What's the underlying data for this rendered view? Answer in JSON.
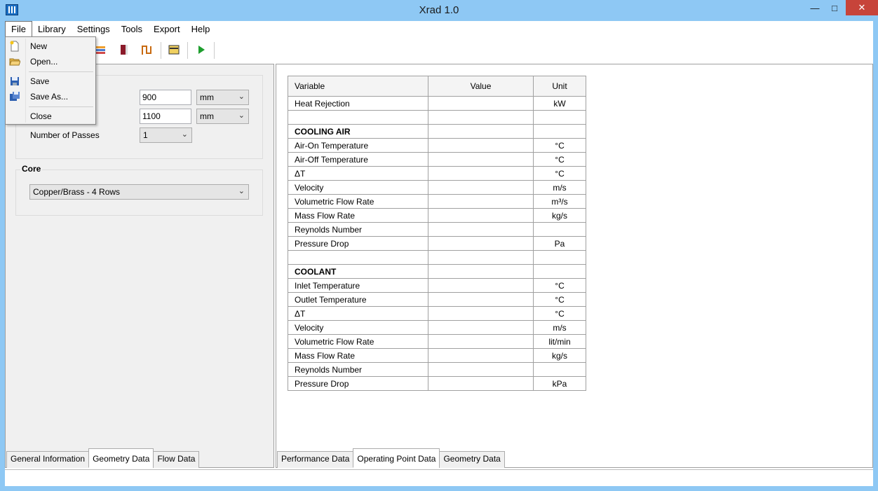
{
  "window": {
    "title": "Xrad 1.0"
  },
  "menu": {
    "items": [
      "File",
      "Library",
      "Settings",
      "Tools",
      "Export",
      "Help"
    ]
  },
  "file_menu": {
    "items": [
      {
        "label": "New",
        "icon": "new-file-icon"
      },
      {
        "label": "Open...",
        "icon": "open-folder-icon"
      },
      {
        "label": "Save",
        "icon": "save-disk-icon"
      },
      {
        "label": "Save As...",
        "icon": "save-as-icon"
      },
      {
        "label": "Close",
        "icon": ""
      }
    ]
  },
  "geometry": {
    "width_value": "900",
    "width_unit": "mm",
    "height_value": "1100",
    "height_unit": "mm",
    "passes_label": "Number of Passes",
    "passes_value": "1"
  },
  "core": {
    "label": "Core",
    "value": "Copper/Brass - 4 Rows"
  },
  "left_tabs": [
    "General Information",
    "Geometry Data",
    "Flow Data"
  ],
  "left_selected_tab": "Geometry Data",
  "right_tabs": [
    "Performance Data",
    "Operating Point Data",
    "Geometry Data"
  ],
  "right_selected_tab": "Operating Point Data",
  "table": {
    "headers": [
      "Variable",
      "Value",
      "Unit"
    ],
    "rows": [
      {
        "variable": "Heat Rejection",
        "value": "",
        "unit": "kW"
      },
      {
        "variable": "",
        "value": "",
        "unit": ""
      },
      {
        "variable": "COOLING AIR",
        "value": "",
        "unit": "",
        "section": true
      },
      {
        "variable": "Air-On Temperature",
        "value": "",
        "unit": "°C"
      },
      {
        "variable": "Air-Off Temperature",
        "value": "",
        "unit": "°C"
      },
      {
        "variable": "ΔT",
        "value": "",
        "unit": "°C"
      },
      {
        "variable": "Velocity",
        "value": "",
        "unit": "m/s"
      },
      {
        "variable": "Volumetric Flow Rate",
        "value": "",
        "unit": "m³/s"
      },
      {
        "variable": "Mass Flow Rate",
        "value": "",
        "unit": "kg/s"
      },
      {
        "variable": "Reynolds Number",
        "value": "",
        "unit": ""
      },
      {
        "variable": "Pressure Drop",
        "value": "",
        "unit": "Pa"
      },
      {
        "variable": "",
        "value": "",
        "unit": ""
      },
      {
        "variable": "COOLANT",
        "value": "",
        "unit": "",
        "section": true
      },
      {
        "variable": "Inlet Temperature",
        "value": "",
        "unit": "°C"
      },
      {
        "variable": "Outlet Temperature",
        "value": "",
        "unit": "°C"
      },
      {
        "variable": "ΔT",
        "value": "",
        "unit": "°C"
      },
      {
        "variable": "Velocity",
        "value": "",
        "unit": "m/s"
      },
      {
        "variable": "Volumetric Flow Rate",
        "value": "",
        "unit": "lit/min"
      },
      {
        "variable": "Mass Flow Rate",
        "value": "",
        "unit": "kg/s"
      },
      {
        "variable": "Reynolds Number",
        "value": "",
        "unit": ""
      },
      {
        "variable": "Pressure Drop",
        "value": "",
        "unit": "kPa"
      }
    ]
  },
  "colors": {
    "titlebar": "#8ec8f4",
    "close_button": "#c7443a",
    "panel": "#f0f0f0",
    "run_icon": "#1e9e2e"
  }
}
